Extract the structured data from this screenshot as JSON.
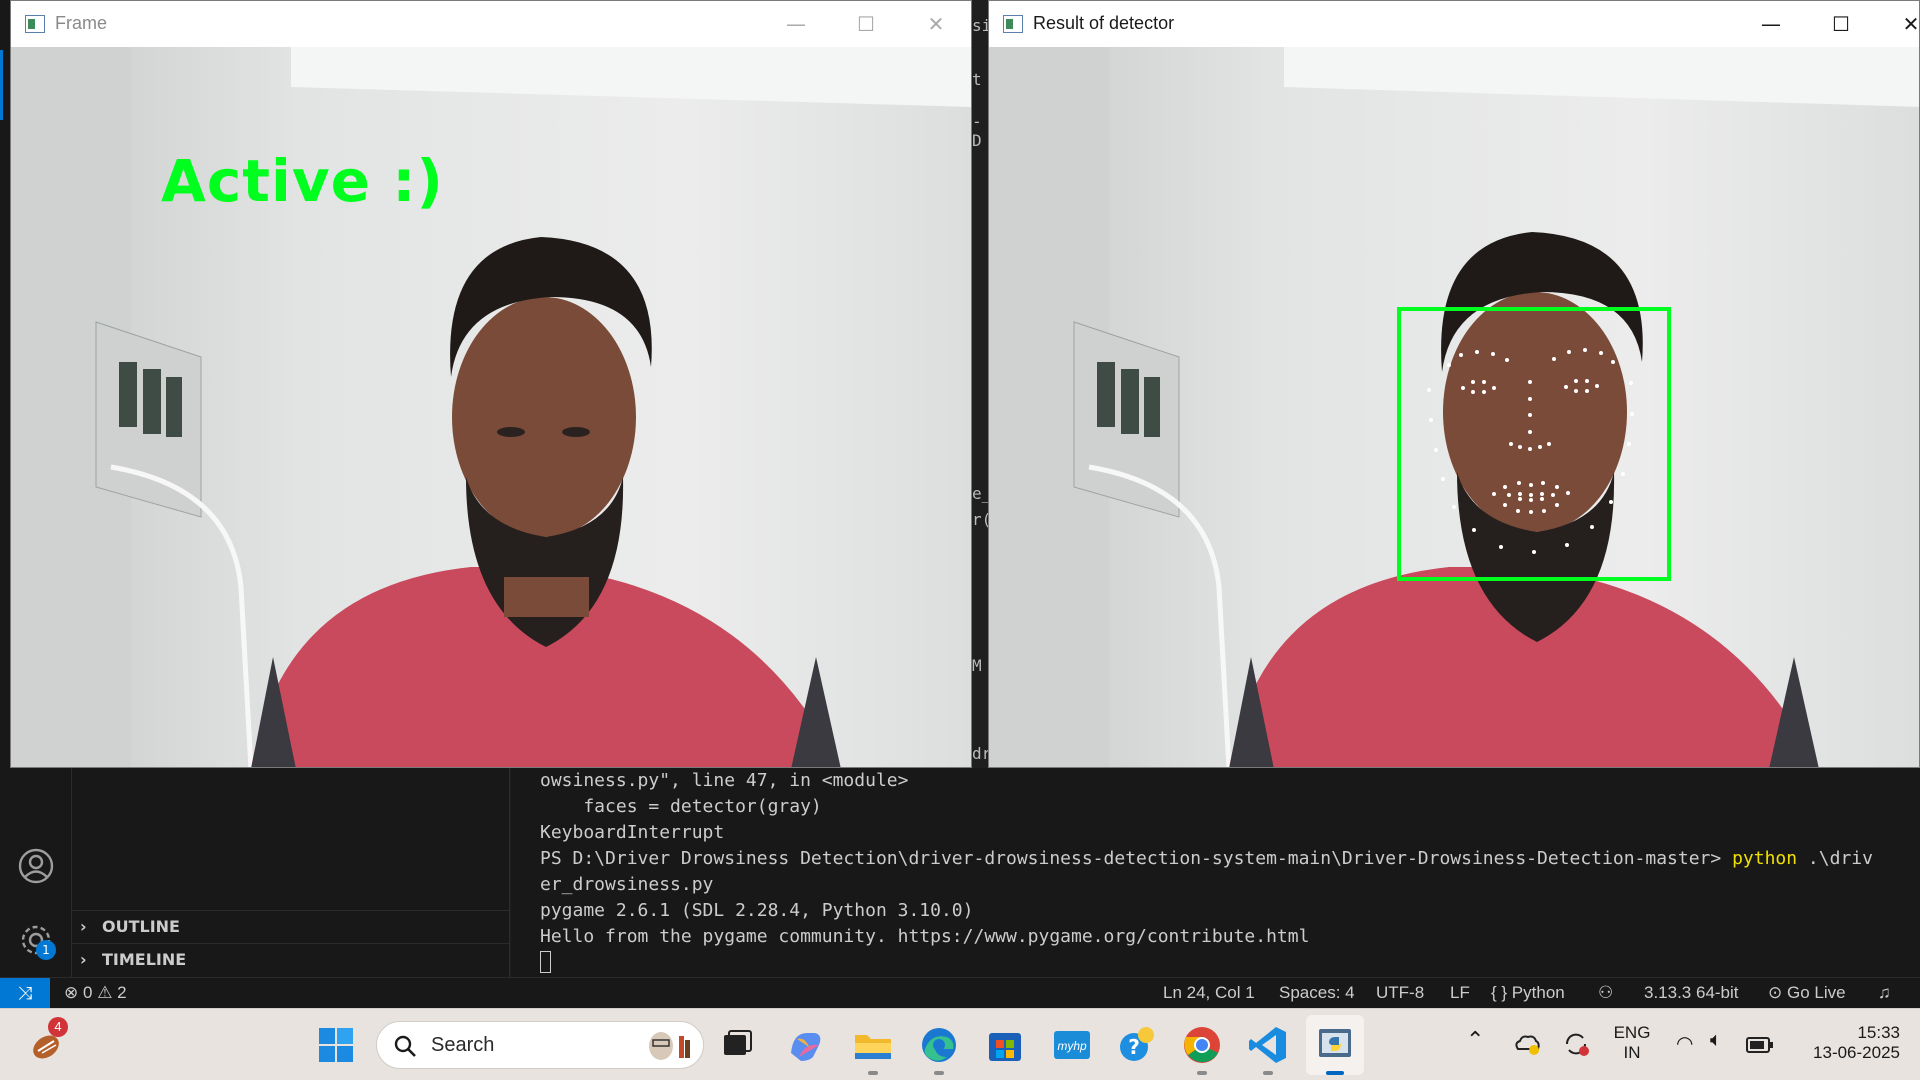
{
  "frame_window": {
    "title": "Frame",
    "status_text": "Active :)",
    "controls": {
      "minimize": "—",
      "maximize": "☐",
      "close": "✕"
    }
  },
  "detector_window": {
    "title": "Result of detector",
    "controls": {
      "minimize": "—",
      "maximize": "☐",
      "close": "✕"
    }
  },
  "editor_fragments": [
    "si",
    "t",
    "-D",
    "e_",
    "r(",
    "M",
    "dr"
  ],
  "sidebar": {
    "sections": [
      {
        "label": "OUTLINE"
      },
      {
        "label": "TIMELINE"
      }
    ],
    "settings_badge": "1"
  },
  "terminal": {
    "lines": [
      "owsiness.py\", line 47, in <module>",
      "    faces = detector(gray)",
      "KeyboardInterrupt"
    ],
    "prompt": "PS D:\\Driver Drowsiness Detection\\driver-drowsiness-detection-system-main\\Driver-Drowsiness-Detection-master> ",
    "command": "python",
    "command_arg": " .\\driv",
    "command_wrap": "er_drowsiness.py",
    "output": [
      "pygame 2.6.1 (SDL 2.28.4, Python 3.10.0)",
      "Hello from the pygame community. https://www.pygame.org/contribute.html"
    ]
  },
  "statusbar": {
    "errors": "0",
    "warnings": "2",
    "position": "Ln 24, Col 1",
    "spaces": "Spaces: 4",
    "encoding": "UTF-8",
    "eol": "LF",
    "language": "{ } Python",
    "interpreter": "3.13.3 64-bit",
    "go_live": "Go Live"
  },
  "taskbar": {
    "search_placeholder": "Search",
    "notification_count": "4",
    "language_top": "ENG",
    "language_bottom": "IN",
    "time": "15:33",
    "date": "13-06-2025",
    "icons": [
      "start-icon",
      "task-view-icon",
      "copilot-icon",
      "file-explorer-icon",
      "edge-icon",
      "store-icon",
      "myhp-icon",
      "help-icon",
      "chrome-icon",
      "vscode-icon",
      "python-icon"
    ]
  },
  "colors": {
    "status_green": "#00ff1e",
    "vscode_accent": "#0078d4",
    "terminal_command": "#f0e000"
  }
}
